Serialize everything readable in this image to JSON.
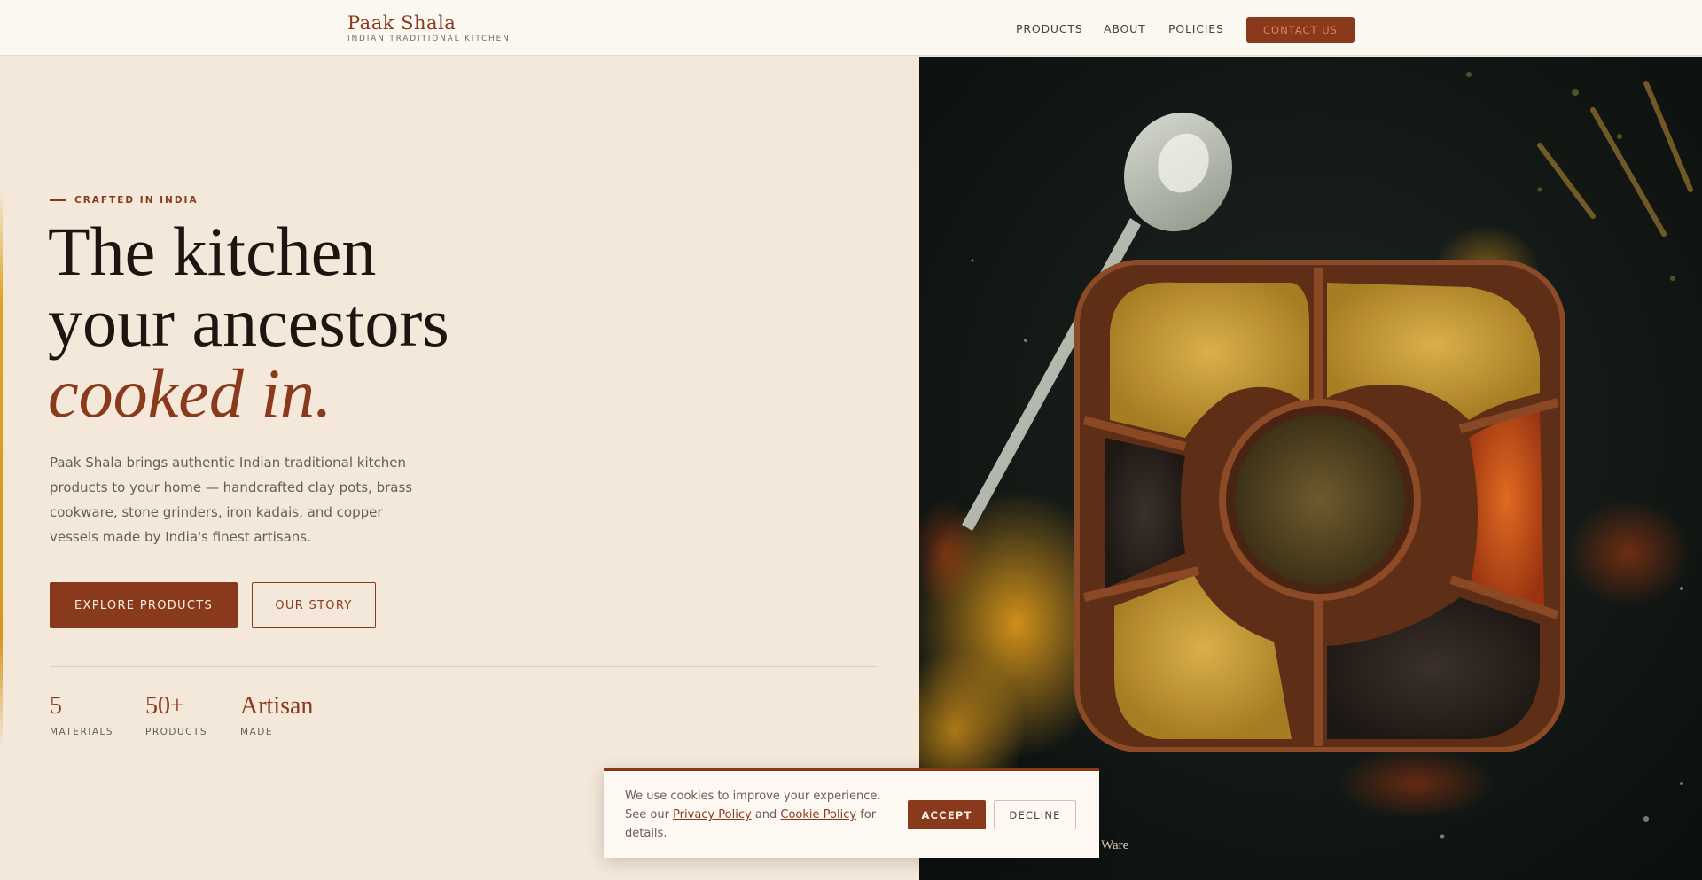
{
  "header": {
    "brand_name": "Paak Shala",
    "brand_tagline": "INDIAN TRADITIONAL KITCHEN",
    "nav": [
      "PRODUCTS",
      "ABOUT",
      "POLICIES"
    ],
    "contact_label": "CONTACT US"
  },
  "hero": {
    "eyebrow": "CRAFTED IN INDIA",
    "headline_line1": "The kitchen",
    "headline_line2": "your ancestors",
    "headline_line3": "cooked in.",
    "intro": "Paak Shala brings authentic Indian traditional kitchen products to your home — handcrafted clay pots, brass cookware, stone grinders, iron kadais, and copper vessels made by India's finest artisans.",
    "primary_button": "EXPLORE PRODUCTS",
    "secondary_button": "OUR STORY",
    "stats": [
      {
        "value": "5",
        "label": "MATERIALS"
      },
      {
        "value": "50+",
        "label": "PRODUCTS"
      },
      {
        "value": "Artisan",
        "label": "MADE"
      }
    ],
    "image_caption": "Ware"
  },
  "cookie": {
    "text_before": "We use cookies to improve your experience. See our ",
    "privacy_link": "Privacy Policy",
    "and_text": " and ",
    "cookie_link": "Cookie Policy",
    "text_after": " for details.",
    "accept_label": "ACCEPT",
    "decline_label": "DECLINE"
  },
  "colors": {
    "brand": "#8a3a1c",
    "background": "#f3e8da",
    "header_bg": "#fbf7f1",
    "accent_gold": "#e0a21f"
  }
}
